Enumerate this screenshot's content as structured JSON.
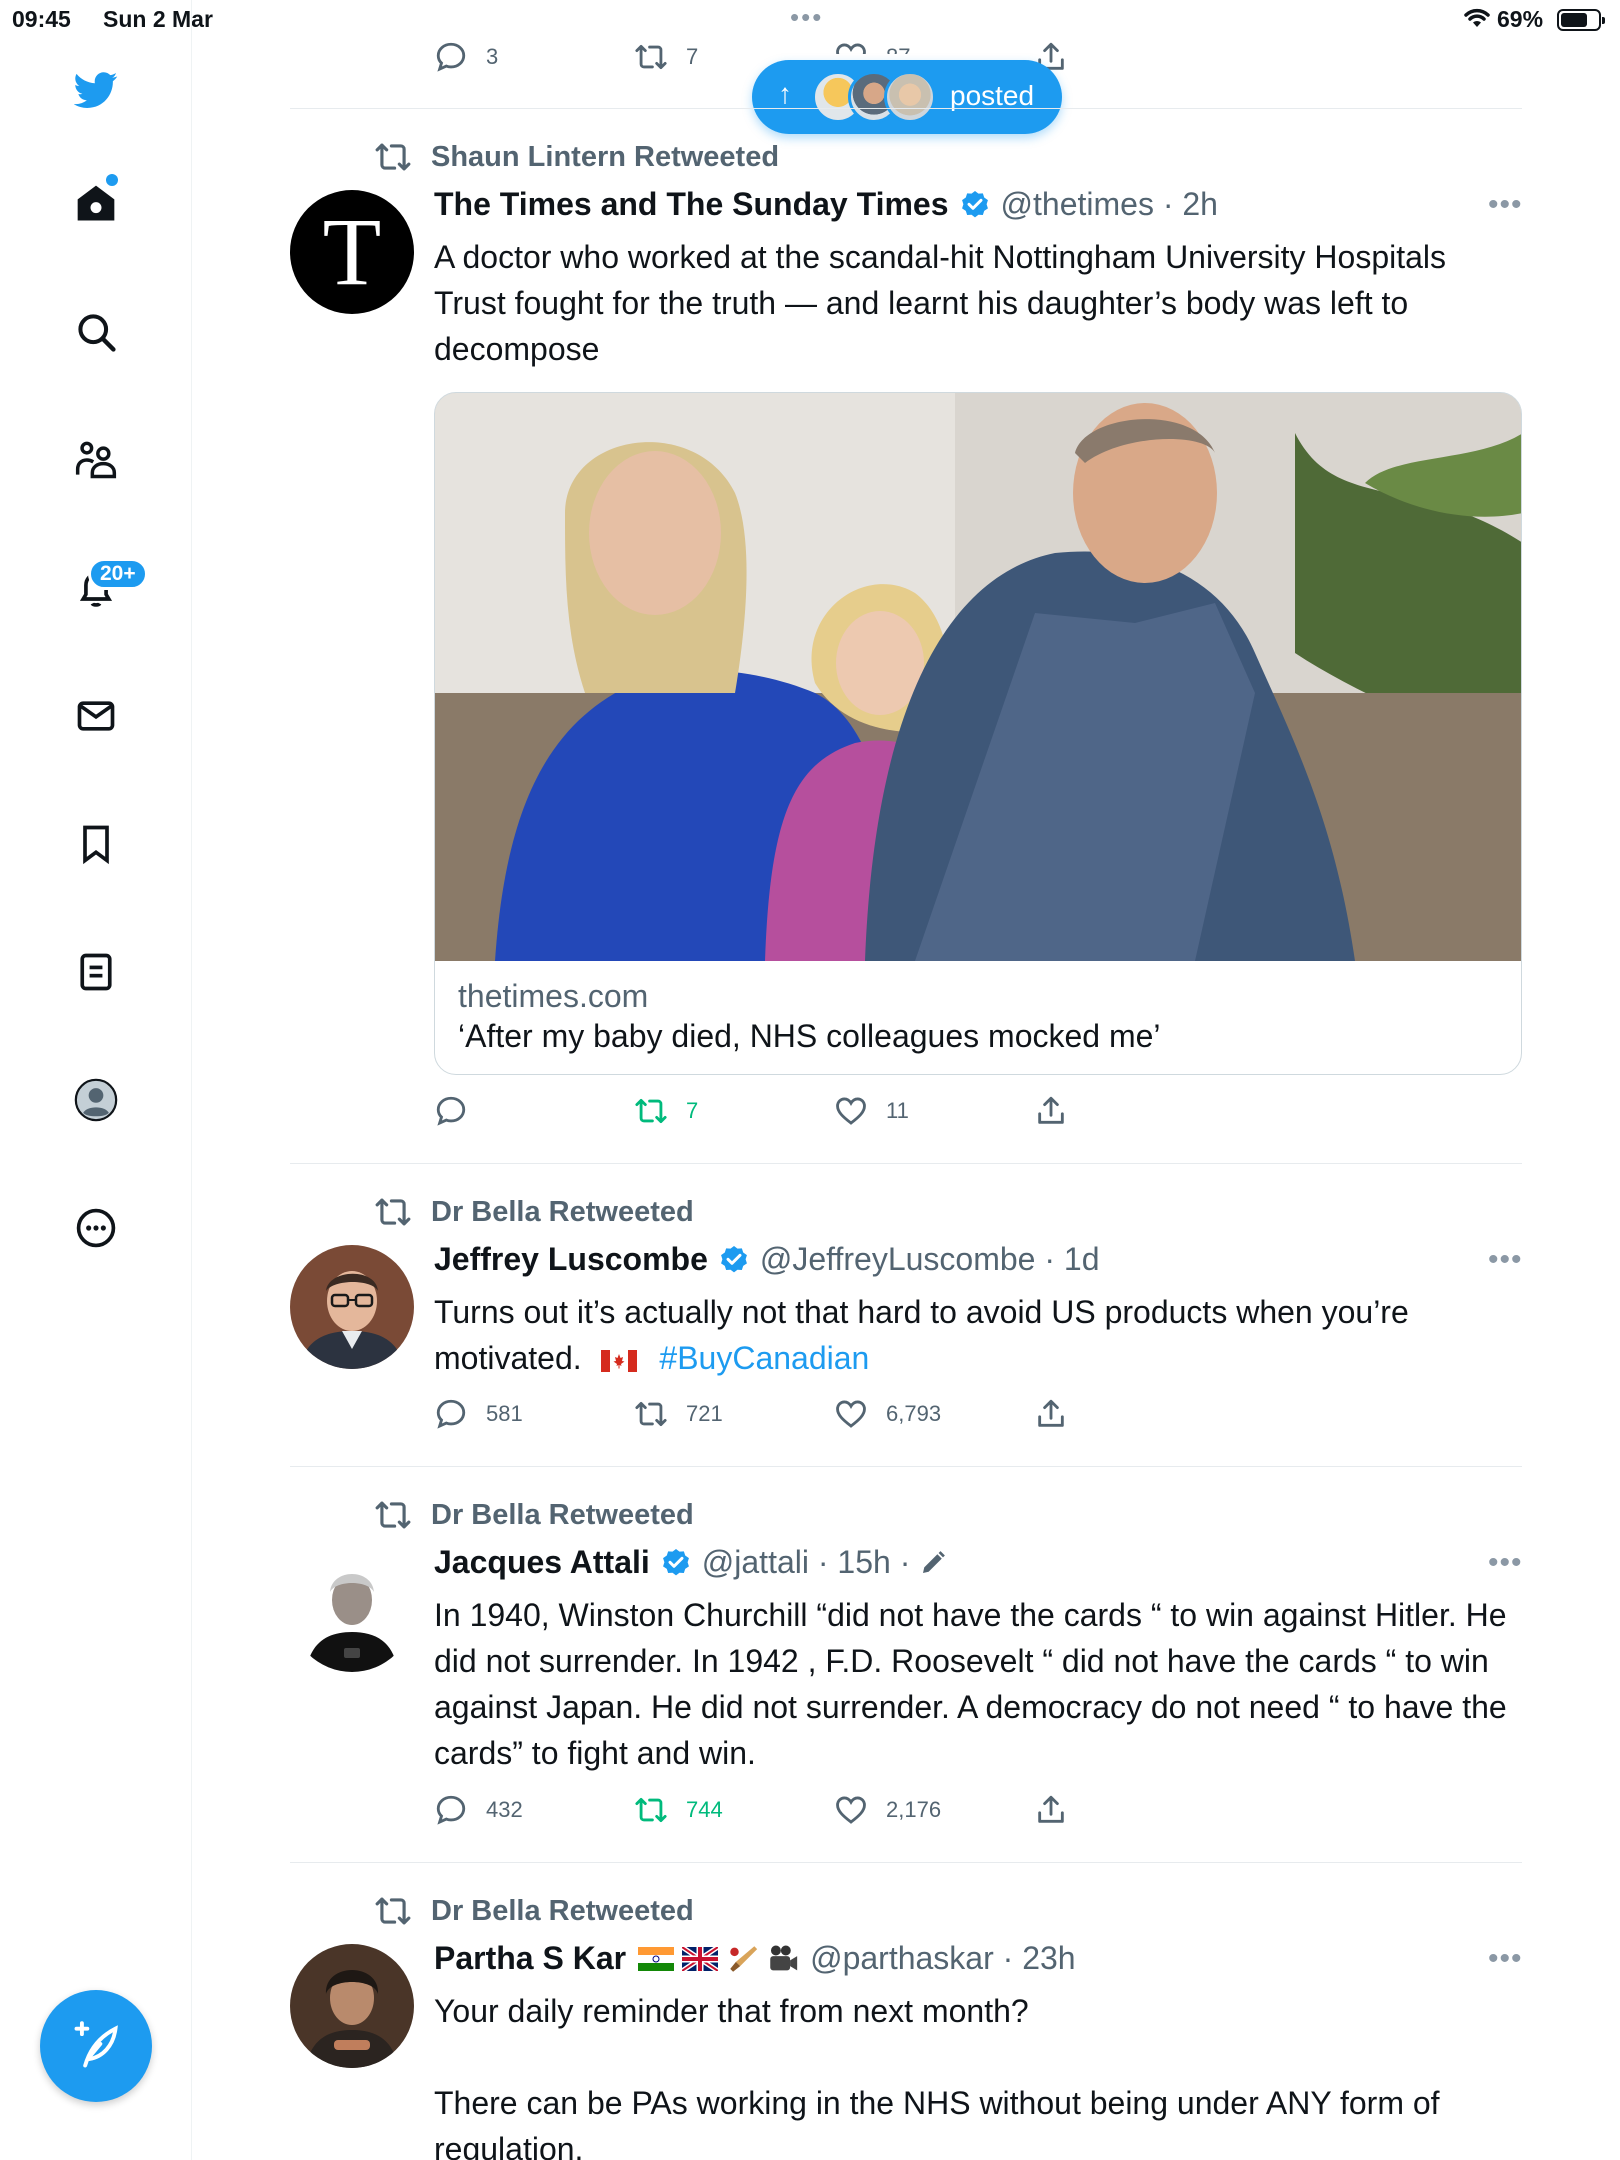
{
  "status_bar": {
    "time": "09:45",
    "date": "Sun 2 Mar",
    "battery": "69%"
  },
  "sidebar": {
    "notifications_badge": "20+"
  },
  "posted_pill": {
    "label": "posted"
  },
  "top_tweet_actions": {
    "replies": "3",
    "retweets": "7",
    "likes": "87"
  },
  "tweets": [
    {
      "retweeted_by": "Shaun Lintern Retweeted",
      "name": "The Times and The Sunday Times",
      "handle": "@thetimes · 2h",
      "text": "A doctor who worked at the scandal-hit Nottingham University Hospitals Trust fought for the truth — and learnt his daughter’s body was left to decompose",
      "card": {
        "domain": "thetimes.com",
        "headline": "‘After my baby died, NHS colleagues mocked me’"
      },
      "replies": "",
      "retweets": "7",
      "likes": "11"
    },
    {
      "retweeted_by": "Dr Bella Retweeted",
      "name": "Jeffrey Luscombe",
      "handle": "@JeffreyLuscombe · 1d",
      "text": "Turns out it’s actually not that hard to avoid US products when you’re motivated.",
      "hashtag": "#BuyCanadian",
      "replies": "581",
      "retweets": "721",
      "likes": "6,793"
    },
    {
      "retweeted_by": "Dr Bella Retweeted",
      "name": "Jacques Attali",
      "handle": "@jattali · 15h ·",
      "text": "In 1940, Winston Churchill “did not have the cards “ to win against Hitler. He did not surrender.  In 1942 , F.D. Roosevelt “ did not have the cards “ to win against Japan.  He did not surrender.  A democracy do not need “ to have the cards” to fight and win.",
      "replies": "432",
      "retweets": "744",
      "likes": "2,176"
    },
    {
      "retweeted_by": "Dr Bella Retweeted",
      "name": "Partha S Kar",
      "handle": "@parthaskar · 23h",
      "text_line1": "Your daily reminder that from next month?",
      "text_line2": "There can be PAs working in the NHS without being under ANY form of regulation."
    }
  ],
  "colors": {
    "accent": "#1d9bf0",
    "retweet_green": "#00ba7c",
    "muted": "#536471"
  }
}
